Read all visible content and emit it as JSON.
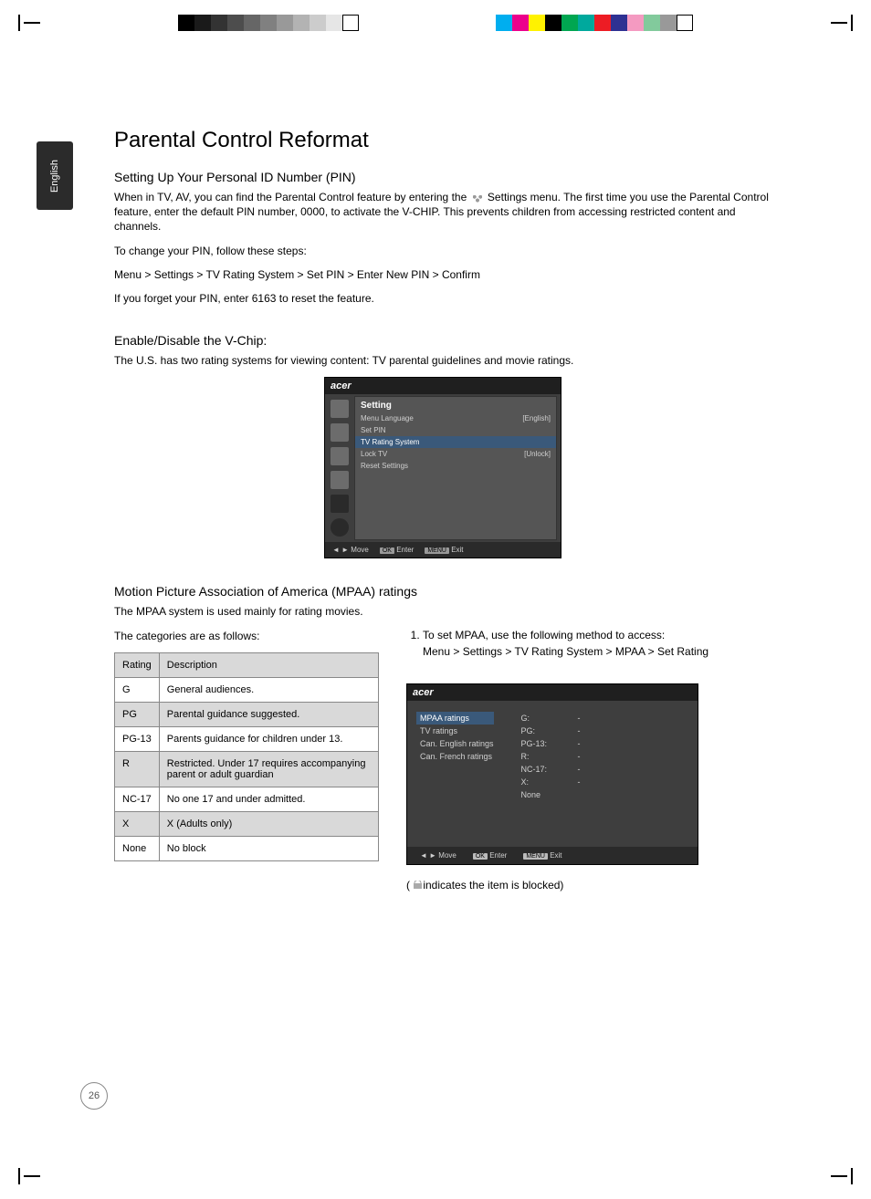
{
  "lang_tab": "English",
  "page_number": "26",
  "title": "Parental Control Reformat",
  "section1": {
    "heading": "Setting Up Your Personal ID Number (PIN)",
    "p1a": "When in TV, AV, you can find the Parental Control feature by entering the ",
    "p1b": " Settings menu. The first time you use the Parental Control feature, enter the default  PIN number, 0000, to activate the V-CHIP. This prevents children from accessing restricted content and channels.",
    "p2": "To change your PIN, follow these steps:",
    "p3": "Menu > Settings > TV Rating System > Set PIN > Enter New PIN > Confirm",
    "p4": "If you forget your PIN, enter 6163 to reset the feature."
  },
  "section2": {
    "heading": "Enable/Disable the V-Chip:",
    "p1": "The U.S. has two rating systems for viewing content: TV parental guidelines and movie ratings."
  },
  "osd1": {
    "brand": "acer",
    "panel_title": "Setting",
    "rows": [
      {
        "label": "Menu Language",
        "value": "[English]"
      },
      {
        "label": "Set PIN",
        "value": ""
      },
      {
        "label": "TV Rating System",
        "value": "",
        "selected": true
      },
      {
        "label": "Lock TV",
        "value": "[Unlock]"
      },
      {
        "label": "Reset Settings",
        "value": ""
      }
    ],
    "footer": {
      "move": "Move",
      "ok": "OK",
      "enter": "Enter",
      "menu": "MENU",
      "exit": "Exit"
    }
  },
  "section3": {
    "heading": "Motion Picture Association of America (MPAA) ratings",
    "p1": "The MPAA system is used mainly for rating movies.",
    "p2": "The categories are as follows:"
  },
  "rating_table": {
    "headers": [
      "Rating",
      "Description"
    ],
    "rows": [
      [
        "G",
        "General audiences."
      ],
      [
        "PG",
        "Parental guidance suggested."
      ],
      [
        "PG-13",
        "Parents guidance for children under 13."
      ],
      [
        "R",
        "Restricted. Under 17 requires accompanying parent or adult guardian"
      ],
      [
        "NC-17",
        "No one 17 and under admitted."
      ],
      [
        "X",
        "X (Adults only)"
      ],
      [
        "None",
        "No block"
      ]
    ]
  },
  "steps": {
    "item1": "To set MPAA, use the following method to access:",
    "path": "Menu > Settings > TV Rating System > MPAA > Set Rating"
  },
  "osd2": {
    "brand": "acer",
    "left": [
      {
        "label": "MPAA ratings",
        "selected": true
      },
      {
        "label": "TV ratings"
      },
      {
        "label": "Can. English ratings"
      },
      {
        "label": "Can. French ratings"
      }
    ],
    "right": [
      {
        "k": "G:",
        "v": "-"
      },
      {
        "k": "PG:",
        "v": "-"
      },
      {
        "k": "PG-13:",
        "v": "-"
      },
      {
        "k": "R:",
        "v": "-"
      },
      {
        "k": "NC-17:",
        "v": "-"
      },
      {
        "k": "X:",
        "v": "-"
      },
      {
        "k": "None",
        "v": ""
      }
    ],
    "footer": {
      "move": "Move",
      "ok": "OK",
      "enter": "Enter",
      "menu": "MENU",
      "exit": "Exit"
    }
  },
  "lock_note_a": "( ",
  "lock_note_b": "indicates the item is blocked)",
  "swatch_colors": [
    "#00aeef",
    "#ec008c",
    "#fff200",
    "#000000",
    "#00a651",
    "#00a99d",
    "#ed1c24",
    "#2e3192",
    "#f49ac1",
    "#82ca9c",
    "#999999",
    "#ffffff"
  ],
  "gray_levels": [
    "#000",
    "#1a1a1a",
    "#333",
    "#4d4d4d",
    "#666",
    "#808080",
    "#999",
    "#b3b3b3",
    "#ccc",
    "#e6e6e6",
    "#fff"
  ]
}
